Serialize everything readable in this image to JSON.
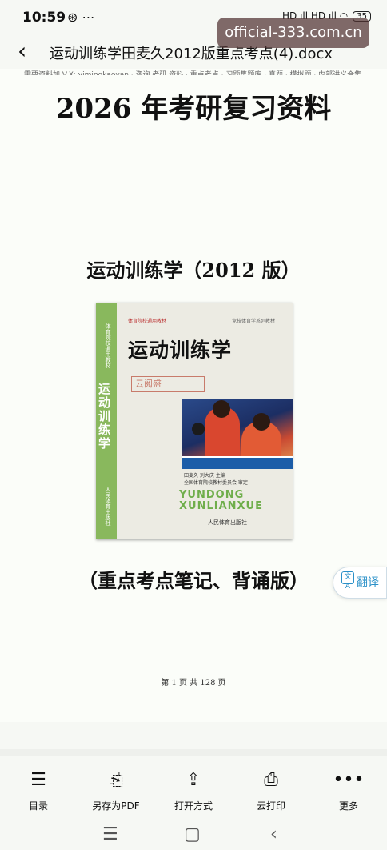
{
  "status_bar": {
    "time": "10:59",
    "notif": "⊛ ⋯",
    "signal": "HD ıll HD ıll ◠",
    "battery": "35"
  },
  "header": {
    "back_glyph": "‹",
    "title": "运动训练学田麦久2012版重点考点(4).docx"
  },
  "watermark": {
    "text": "official-333.com.cn"
  },
  "document": {
    "cut_line": "需要资料加 V.X: yimingkaoyan · 咨询 考研 资料 · 重点考点 · 习题集题库 · 真题 · 模拟题 · 内部讲义合集",
    "main_heading": "2026 年考研复习资料",
    "book_heading": "运动训练学（2012 版）",
    "edition_note": "（重点考点笔记、背诵版）",
    "page_indicator": "第 1 页 共 128 页"
  },
  "cover": {
    "spine_title": "运动训练学",
    "spine_top": "体育院校通用教材",
    "spine_pub": "人民体育出版社",
    "top_line": "体育院校通用教材",
    "series": "竞技体育学系列教材",
    "title": "运动训练学",
    "stamp": "云阅盛",
    "authors_1": "田麦久  刘大庆 主编",
    "authors_2": "全国体育院校教材委员会 审定",
    "pinyin_1": "YUNDONG",
    "pinyin_2": "XUNLIANXUE",
    "press": "人民体育出版社"
  },
  "translate_button": {
    "icon": "文A",
    "label": "翻译"
  },
  "toolbar": [
    {
      "icon": "☰",
      "label": "目录"
    },
    {
      "icon": "⎘",
      "label": "另存为PDF"
    },
    {
      "icon": "⇪",
      "label": "打开方式"
    },
    {
      "icon": "⎙",
      "label": "云打印"
    },
    {
      "icon": "•••",
      "label": "更多"
    }
  ],
  "nav_bar": {
    "menu": "☰",
    "home": "▢",
    "back": "‹"
  }
}
